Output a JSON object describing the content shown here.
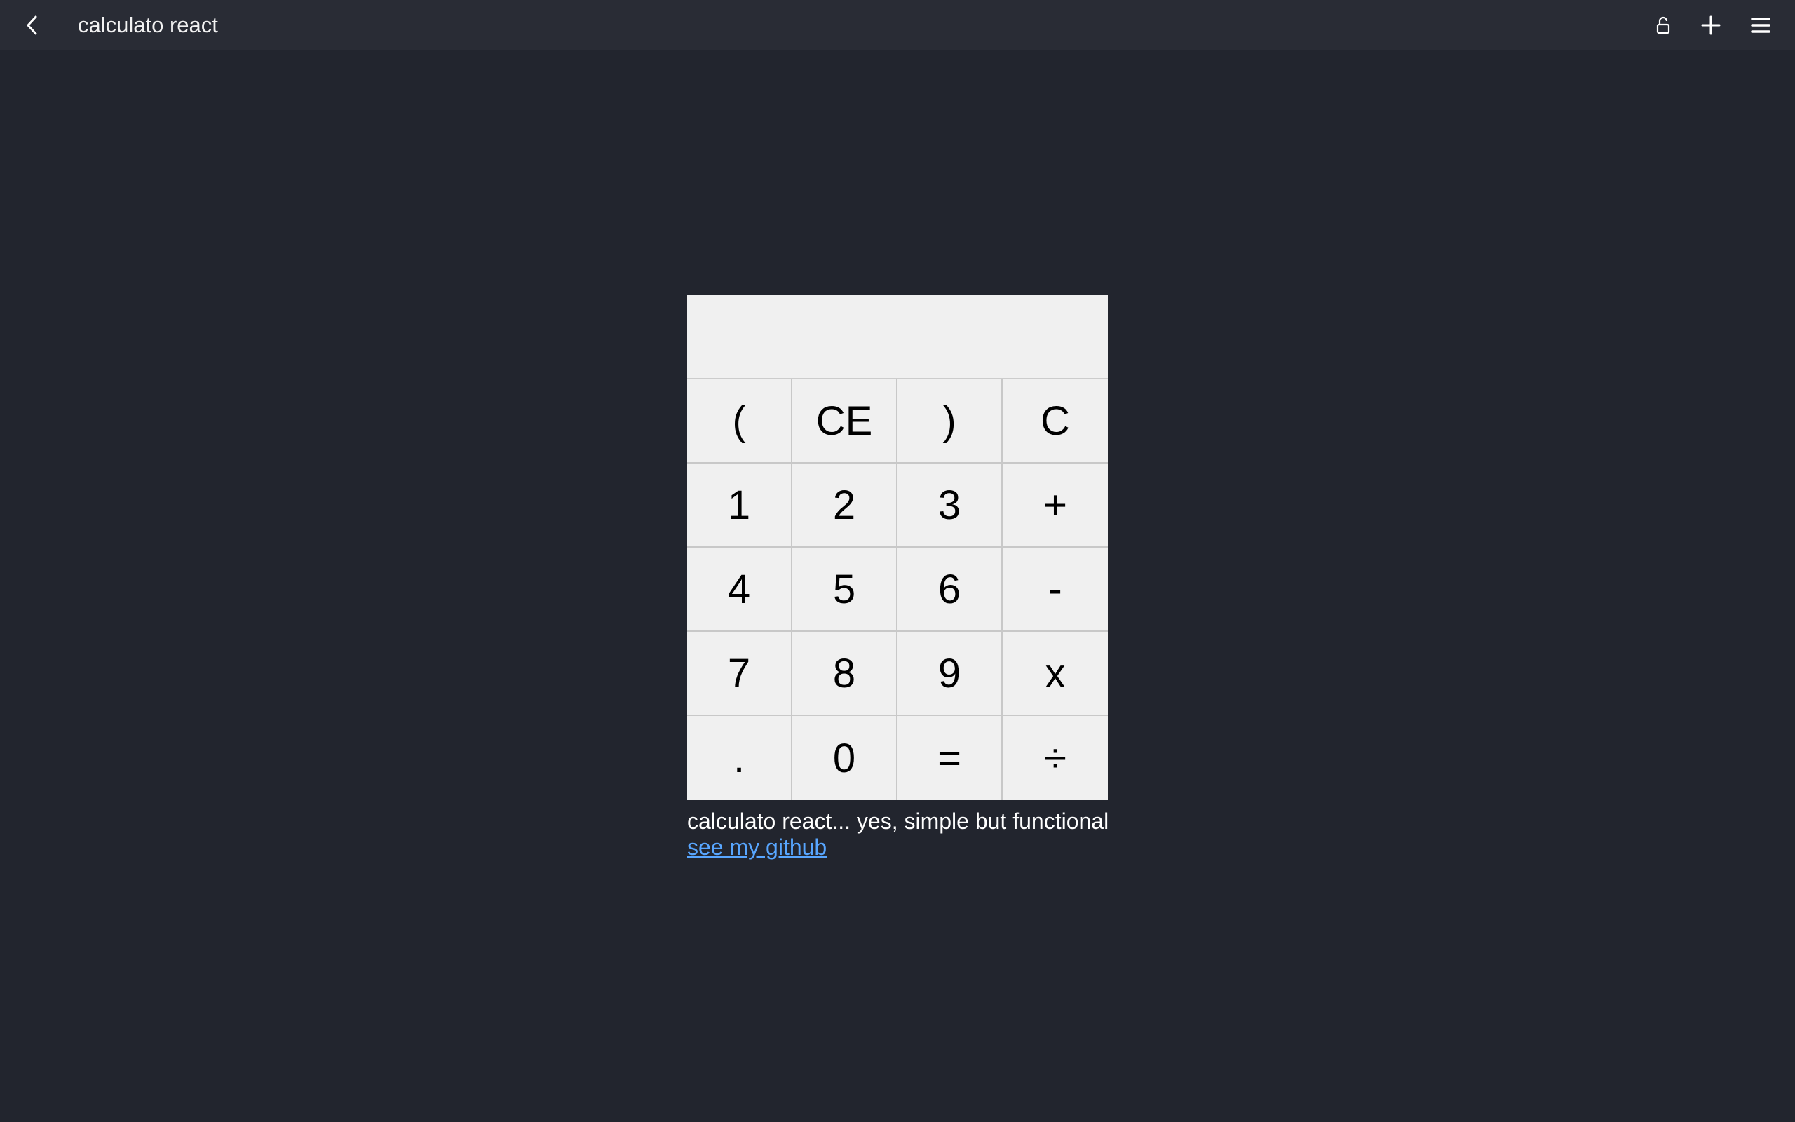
{
  "topbar": {
    "title": "calculato react",
    "icons": {
      "back": "chevron-left-icon",
      "lock": "unlock-icon",
      "add": "plus-icon",
      "menu": "hamburger-menu-icon"
    }
  },
  "calculator": {
    "display_value": "",
    "keys": [
      [
        "(",
        "CE",
        ")",
        "C"
      ],
      [
        "1",
        "2",
        "3",
        "+"
      ],
      [
        "4",
        "5",
        "6",
        "-"
      ],
      [
        "7",
        "8",
        "9",
        "x"
      ],
      [
        ".",
        "0",
        "=",
        "÷"
      ]
    ]
  },
  "footer": {
    "caption": "calculato react... yes, simple but functional",
    "link_label": "see my github"
  },
  "colors": {
    "background": "#22252e",
    "topbar": "#292c35",
    "calculator_bg": "#f0f0f0",
    "link": "#58a6ff"
  }
}
